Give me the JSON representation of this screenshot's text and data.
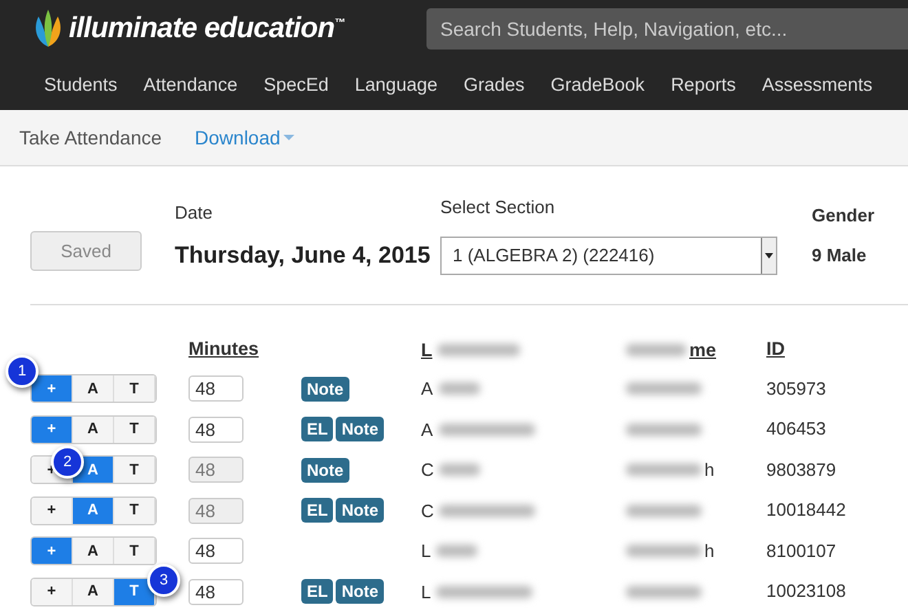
{
  "brand": {
    "name": "illuminate education",
    "trademark": "™"
  },
  "search": {
    "placeholder": "Search Students, Help, Navigation, etc..."
  },
  "nav": [
    "Students",
    "Attendance",
    "SpecEd",
    "Language",
    "Grades",
    "GradeBook",
    "Reports",
    "Assessments"
  ],
  "subnav": {
    "title": "Take Attendance",
    "download": "Download"
  },
  "toolbar": {
    "save_button": "Saved",
    "date_label": "Date",
    "date": "Thursday, June 4, 2015",
    "section_label": "Select Section",
    "section": "1 (ALGEBRA 2) (222416)",
    "gender_label": "Gender",
    "gender_value": "9 Male"
  },
  "table": {
    "columns": {
      "minutes": "Minutes",
      "last_name": "L",
      "first_name": "me",
      "id": "ID"
    },
    "rows": [
      {
        "options": [
          {
            "label": "+",
            "selected": true
          },
          {
            "label": "A",
            "selected": false
          },
          {
            "label": "T",
            "selected": false
          }
        ],
        "minutes": "48",
        "minutes_disabled": false,
        "tags": [
          "Note"
        ],
        "last_name": "A",
        "first_name": "",
        "id": "305973",
        "callout": "1"
      },
      {
        "options": [
          {
            "label": "+",
            "selected": true
          },
          {
            "label": "A",
            "selected": false
          },
          {
            "label": "T",
            "selected": false
          }
        ],
        "minutes": "48",
        "minutes_disabled": false,
        "tags": [
          "EL",
          "Note"
        ],
        "last_name": "A",
        "first_name": "",
        "id": "406453"
      },
      {
        "options": [
          {
            "label": "+",
            "selected": false
          },
          {
            "label": "A",
            "selected": true
          },
          {
            "label": "T",
            "selected": false
          }
        ],
        "minutes": "48",
        "minutes_disabled": true,
        "tags": [
          "Note"
        ],
        "last_name": "C",
        "first_name": "h",
        "id": "9803879",
        "callout": "2"
      },
      {
        "options": [
          {
            "label": "+",
            "selected": false
          },
          {
            "label": "A",
            "selected": true
          },
          {
            "label": "T",
            "selected": false
          }
        ],
        "minutes": "48",
        "minutes_disabled": true,
        "tags": [
          "EL",
          "Note"
        ],
        "last_name": "C",
        "first_name": "",
        "id": "10018442"
      },
      {
        "options": [
          {
            "label": "+",
            "selected": true
          },
          {
            "label": "A",
            "selected": false
          },
          {
            "label": "T",
            "selected": false
          }
        ],
        "minutes": "48",
        "minutes_disabled": false,
        "tags": [],
        "last_name": "L",
        "first_name": "h",
        "id": "8100107"
      },
      {
        "options": [
          {
            "label": "+",
            "selected": false
          },
          {
            "label": "A",
            "selected": false
          },
          {
            "label": "T",
            "selected": true
          }
        ],
        "minutes": "48",
        "minutes_disabled": false,
        "tags": [
          "EL",
          "Note"
        ],
        "last_name": "L",
        "first_name": "",
        "id": "10023108",
        "callout": "3"
      }
    ]
  }
}
